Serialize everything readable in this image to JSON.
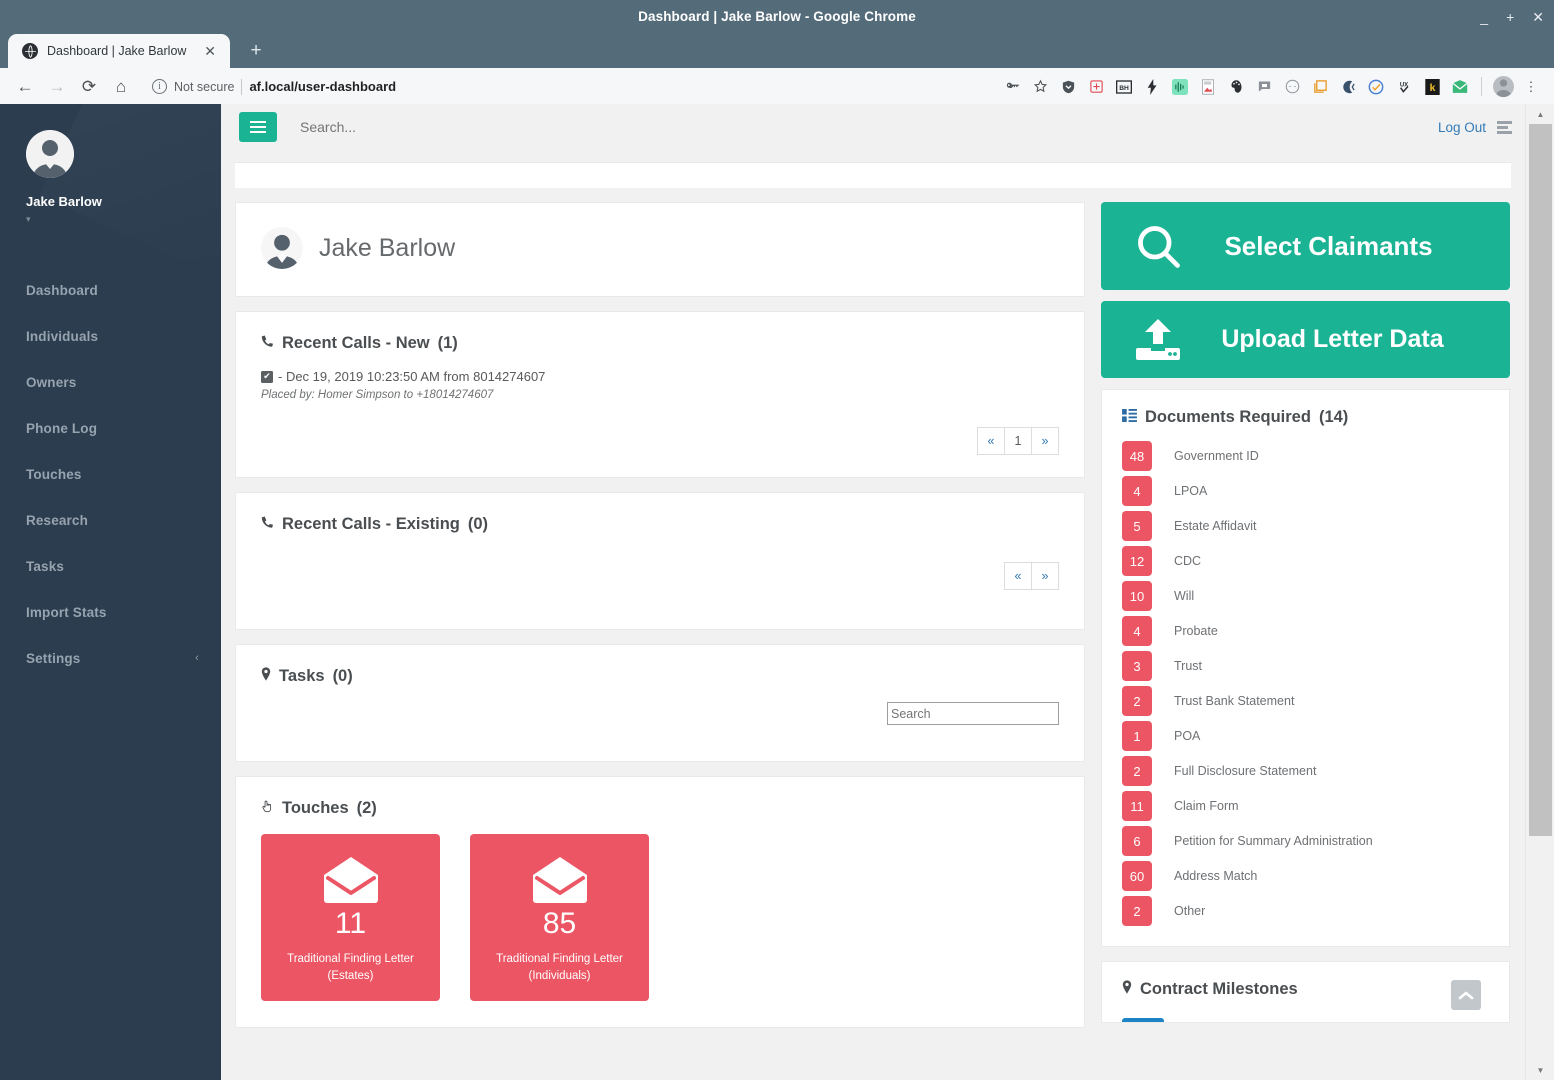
{
  "browser": {
    "window_title": "Dashboard | Jake Barlow - Google Chrome",
    "minimize": "_",
    "maximize": "+",
    "close": "✕",
    "tab_title": "Dashboard | Jake Barlow",
    "tab_close": "✕",
    "new_tab": "+",
    "back": "←",
    "forward": "→",
    "reload": "⟳",
    "home": "⌂",
    "security_icon_text": "i",
    "security_label": "Not secure",
    "url": "af.local/user-dashboard",
    "extension_icons": [
      "key-icon",
      "star-bookmark-icon",
      "shield-icon",
      "medkit-icon",
      "bh-icon",
      "lightning-icon",
      "waveform-icon",
      "pdf-icon",
      "paint-icon",
      "chat-icon",
      "circle-icon",
      "window-icon",
      "moon-icon",
      "check-circle-icon",
      "ux-icon",
      "k-icon",
      "mail-icon"
    ],
    "menu": "⋮"
  },
  "sidebar": {
    "user_name": "Jake Barlow",
    "caret": "▾",
    "items": [
      {
        "label": "Dashboard",
        "chevron": ""
      },
      {
        "label": "Individuals",
        "chevron": ""
      },
      {
        "label": "Owners",
        "chevron": ""
      },
      {
        "label": "Phone Log",
        "chevron": ""
      },
      {
        "label": "Touches",
        "chevron": ""
      },
      {
        "label": "Research",
        "chevron": ""
      },
      {
        "label": "Tasks",
        "chevron": ""
      },
      {
        "label": "Import Stats",
        "chevron": ""
      },
      {
        "label": "Settings",
        "chevron": "‹"
      }
    ]
  },
  "topbar": {
    "search_placeholder": "Search...",
    "logout_label": "Log Out"
  },
  "profile": {
    "name": "Jake Barlow"
  },
  "recent_calls_new": {
    "icon": "phone-icon",
    "title": "Recent Calls - New",
    "count": "(1)",
    "entries": [
      {
        "checkbox": "✔",
        "text": "- Dec 19, 2019 10:23:50 AM from 8014274607",
        "subtext": "Placed by: Homer Simpson to +18014274607"
      }
    ],
    "pager": {
      "prev": "«",
      "page": "1",
      "next": "»"
    }
  },
  "recent_calls_existing": {
    "icon": "phone-icon",
    "title": "Recent Calls - Existing",
    "count": "(0)",
    "pager": {
      "prev": "«",
      "next": "»"
    }
  },
  "tasks": {
    "icon": "pin-icon",
    "title": "Tasks",
    "count": "(0)",
    "search_placeholder": "Search"
  },
  "touches": {
    "icon": "hand-pointer-icon",
    "title": "Touches",
    "count": "(2)",
    "cards": [
      {
        "value": "11",
        "label": "Traditional Finding Letter",
        "sublabel": "(Estates)"
      },
      {
        "value": "85",
        "label": "Traditional Finding Letter",
        "sublabel": "(Individuals)"
      }
    ]
  },
  "actions": {
    "select_claimants": "Select Claimants",
    "upload_letter_data": "Upload Letter Data"
  },
  "documents_required": {
    "icon": "list-icon",
    "title": "Documents Required",
    "count": "(14)",
    "items": [
      {
        "count": "48",
        "label": "Government ID"
      },
      {
        "count": "4",
        "label": "LPOA"
      },
      {
        "count": "5",
        "label": "Estate Affidavit"
      },
      {
        "count": "12",
        "label": "CDC"
      },
      {
        "count": "10",
        "label": "Will"
      },
      {
        "count": "4",
        "label": "Probate"
      },
      {
        "count": "3",
        "label": "Trust"
      },
      {
        "count": "2",
        "label": "Trust Bank Statement"
      },
      {
        "count": "1",
        "label": "POA"
      },
      {
        "count": "2",
        "label": "Full Disclosure Statement"
      },
      {
        "count": "11",
        "label": "Claim Form"
      },
      {
        "count": "6",
        "label": "Petition for Summary Administration"
      },
      {
        "count": "60",
        "label": "Address Match"
      },
      {
        "count": "2",
        "label": "Other"
      }
    ]
  },
  "contract_milestones": {
    "icon": "pin-icon",
    "title": "Contract Milestones"
  },
  "scrollbar": {
    "up": "▲",
    "down": "▼"
  },
  "colors": {
    "accent_green": "#1ab394",
    "badge_red": "#ec5564",
    "sidebar_dark": "#2b3d4f",
    "link_blue": "#337ab7",
    "chrome_frame": "#546b7a"
  }
}
